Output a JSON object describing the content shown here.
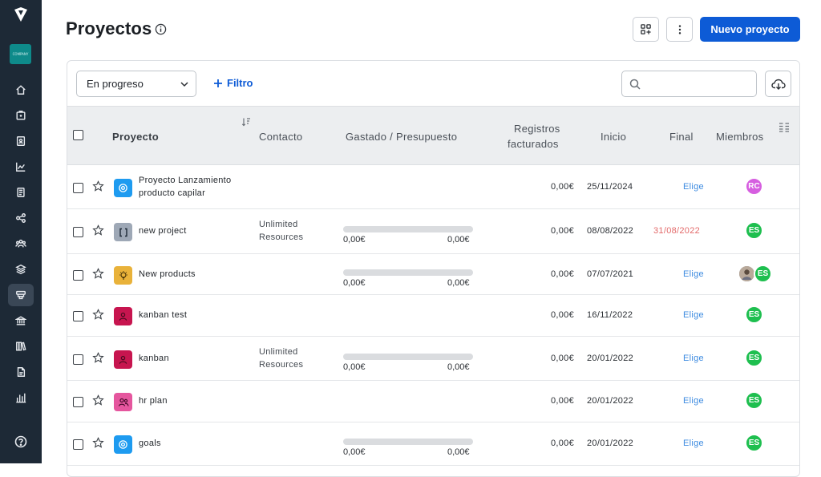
{
  "page": {
    "title": "Proyectos"
  },
  "header": {
    "new_project_label": "Nuevo proyecto"
  },
  "sidebar": {
    "company_text": "COMPANY",
    "items": [
      "home-icon",
      "clock-badge-icon",
      "address-book-icon",
      "chart-line-icon",
      "document-icon",
      "share-nodes-icon",
      "users-icon",
      "layers-icon",
      "projects-icon",
      "bank-icon",
      "library-icon",
      "file-icon",
      "bar-chart-icon"
    ],
    "active_index": 8
  },
  "toolbar": {
    "status_filter_value": "En progreso",
    "filter_label": "Filtro",
    "search_placeholder": ""
  },
  "table": {
    "headers": {
      "project": "Proyecto",
      "contact": "Contacto",
      "spent_budget": "Gastado / Presupuesto",
      "billed_line1": "Registros",
      "billed_line2": "facturados",
      "start": "Inicio",
      "end": "Final",
      "members": "Miembros"
    },
    "rows": [
      {
        "name_line1": "Proyecto Lanzamiento",
        "name_line2": "producto capilar",
        "icon_color": "#1e9bf0",
        "icon": "target-icon",
        "contact_line1": "",
        "contact_line2": "",
        "has_budget": false,
        "spent": "",
        "budget": "",
        "billed": "0,00€",
        "start": "25/11/2024",
        "end": "Elige",
        "end_overdue": false,
        "members": [
          {
            "initials": "RC",
            "color": "#d65ee0"
          }
        ]
      },
      {
        "name_line1": "new project",
        "name_line2": "",
        "icon_color": "#9ea8b6",
        "icon": "brackets-icon",
        "contact_line1": "Unlimited",
        "contact_line2": "Resources",
        "has_budget": true,
        "spent": "0,00€",
        "budget": "0,00€",
        "billed": "0,00€",
        "start": "08/08/2022",
        "end": "31/08/2022",
        "end_overdue": true,
        "members": [
          {
            "initials": "ES",
            "color": "#1ebf4f"
          }
        ]
      },
      {
        "name_line1": "New products",
        "name_line2": "",
        "icon_color": "#e9b23a",
        "icon": "lightbulb-icon",
        "contact_line1": "",
        "contact_line2": "",
        "has_budget": true,
        "spent": "0,00€",
        "budget": "0,00€",
        "billed": "0,00€",
        "start": "07/07/2021",
        "end": "Elige",
        "end_overdue": false,
        "members": [
          {
            "initials": "",
            "color": "#8a8f98",
            "photo": true
          },
          {
            "initials": "ES",
            "color": "#1ebf4f"
          }
        ]
      },
      {
        "name_line1": "kanban test",
        "name_line2": "",
        "icon_color": "#c7154f",
        "icon": "person-icon",
        "contact_line1": "",
        "contact_line2": "",
        "has_budget": false,
        "spent": "",
        "budget": "",
        "billed": "0,00€",
        "start": "16/11/2022",
        "end": "Elige",
        "end_overdue": false,
        "members": [
          {
            "initials": "ES",
            "color": "#1ebf4f"
          }
        ]
      },
      {
        "name_line1": "kanban",
        "name_line2": "",
        "icon_color": "#c7154f",
        "icon": "person-icon",
        "contact_line1": "Unlimited",
        "contact_line2": "Resources",
        "has_budget": true,
        "spent": "0,00€",
        "budget": "0,00€",
        "billed": "0,00€",
        "start": "20/01/2022",
        "end": "Elige",
        "end_overdue": false,
        "members": [
          {
            "initials": "ES",
            "color": "#1ebf4f"
          }
        ]
      },
      {
        "name_line1": "hr plan",
        "name_line2": "",
        "icon_color": "#e5569e",
        "icon": "people-icon",
        "contact_line1": "",
        "contact_line2": "",
        "has_budget": false,
        "spent": "",
        "budget": "",
        "billed": "0,00€",
        "start": "20/01/2022",
        "end": "Elige",
        "end_overdue": false,
        "members": [
          {
            "initials": "ES",
            "color": "#1ebf4f"
          }
        ]
      },
      {
        "name_line1": "goals",
        "name_line2": "",
        "icon_color": "#1e9bf0",
        "icon": "target-icon",
        "contact_line1": "",
        "contact_line2": "",
        "has_budget": true,
        "spent": "0,00€",
        "budget": "0,00€",
        "billed": "0,00€",
        "start": "20/01/2022",
        "end": "Elige",
        "end_overdue": false,
        "members": [
          {
            "initials": "ES",
            "color": "#1ebf4f"
          }
        ]
      }
    ]
  },
  "colors": {
    "sidebar": "#1d2936",
    "accent": "#0d5bd6",
    "overdue": "#e36a6a",
    "link": "#3d8be0"
  }
}
